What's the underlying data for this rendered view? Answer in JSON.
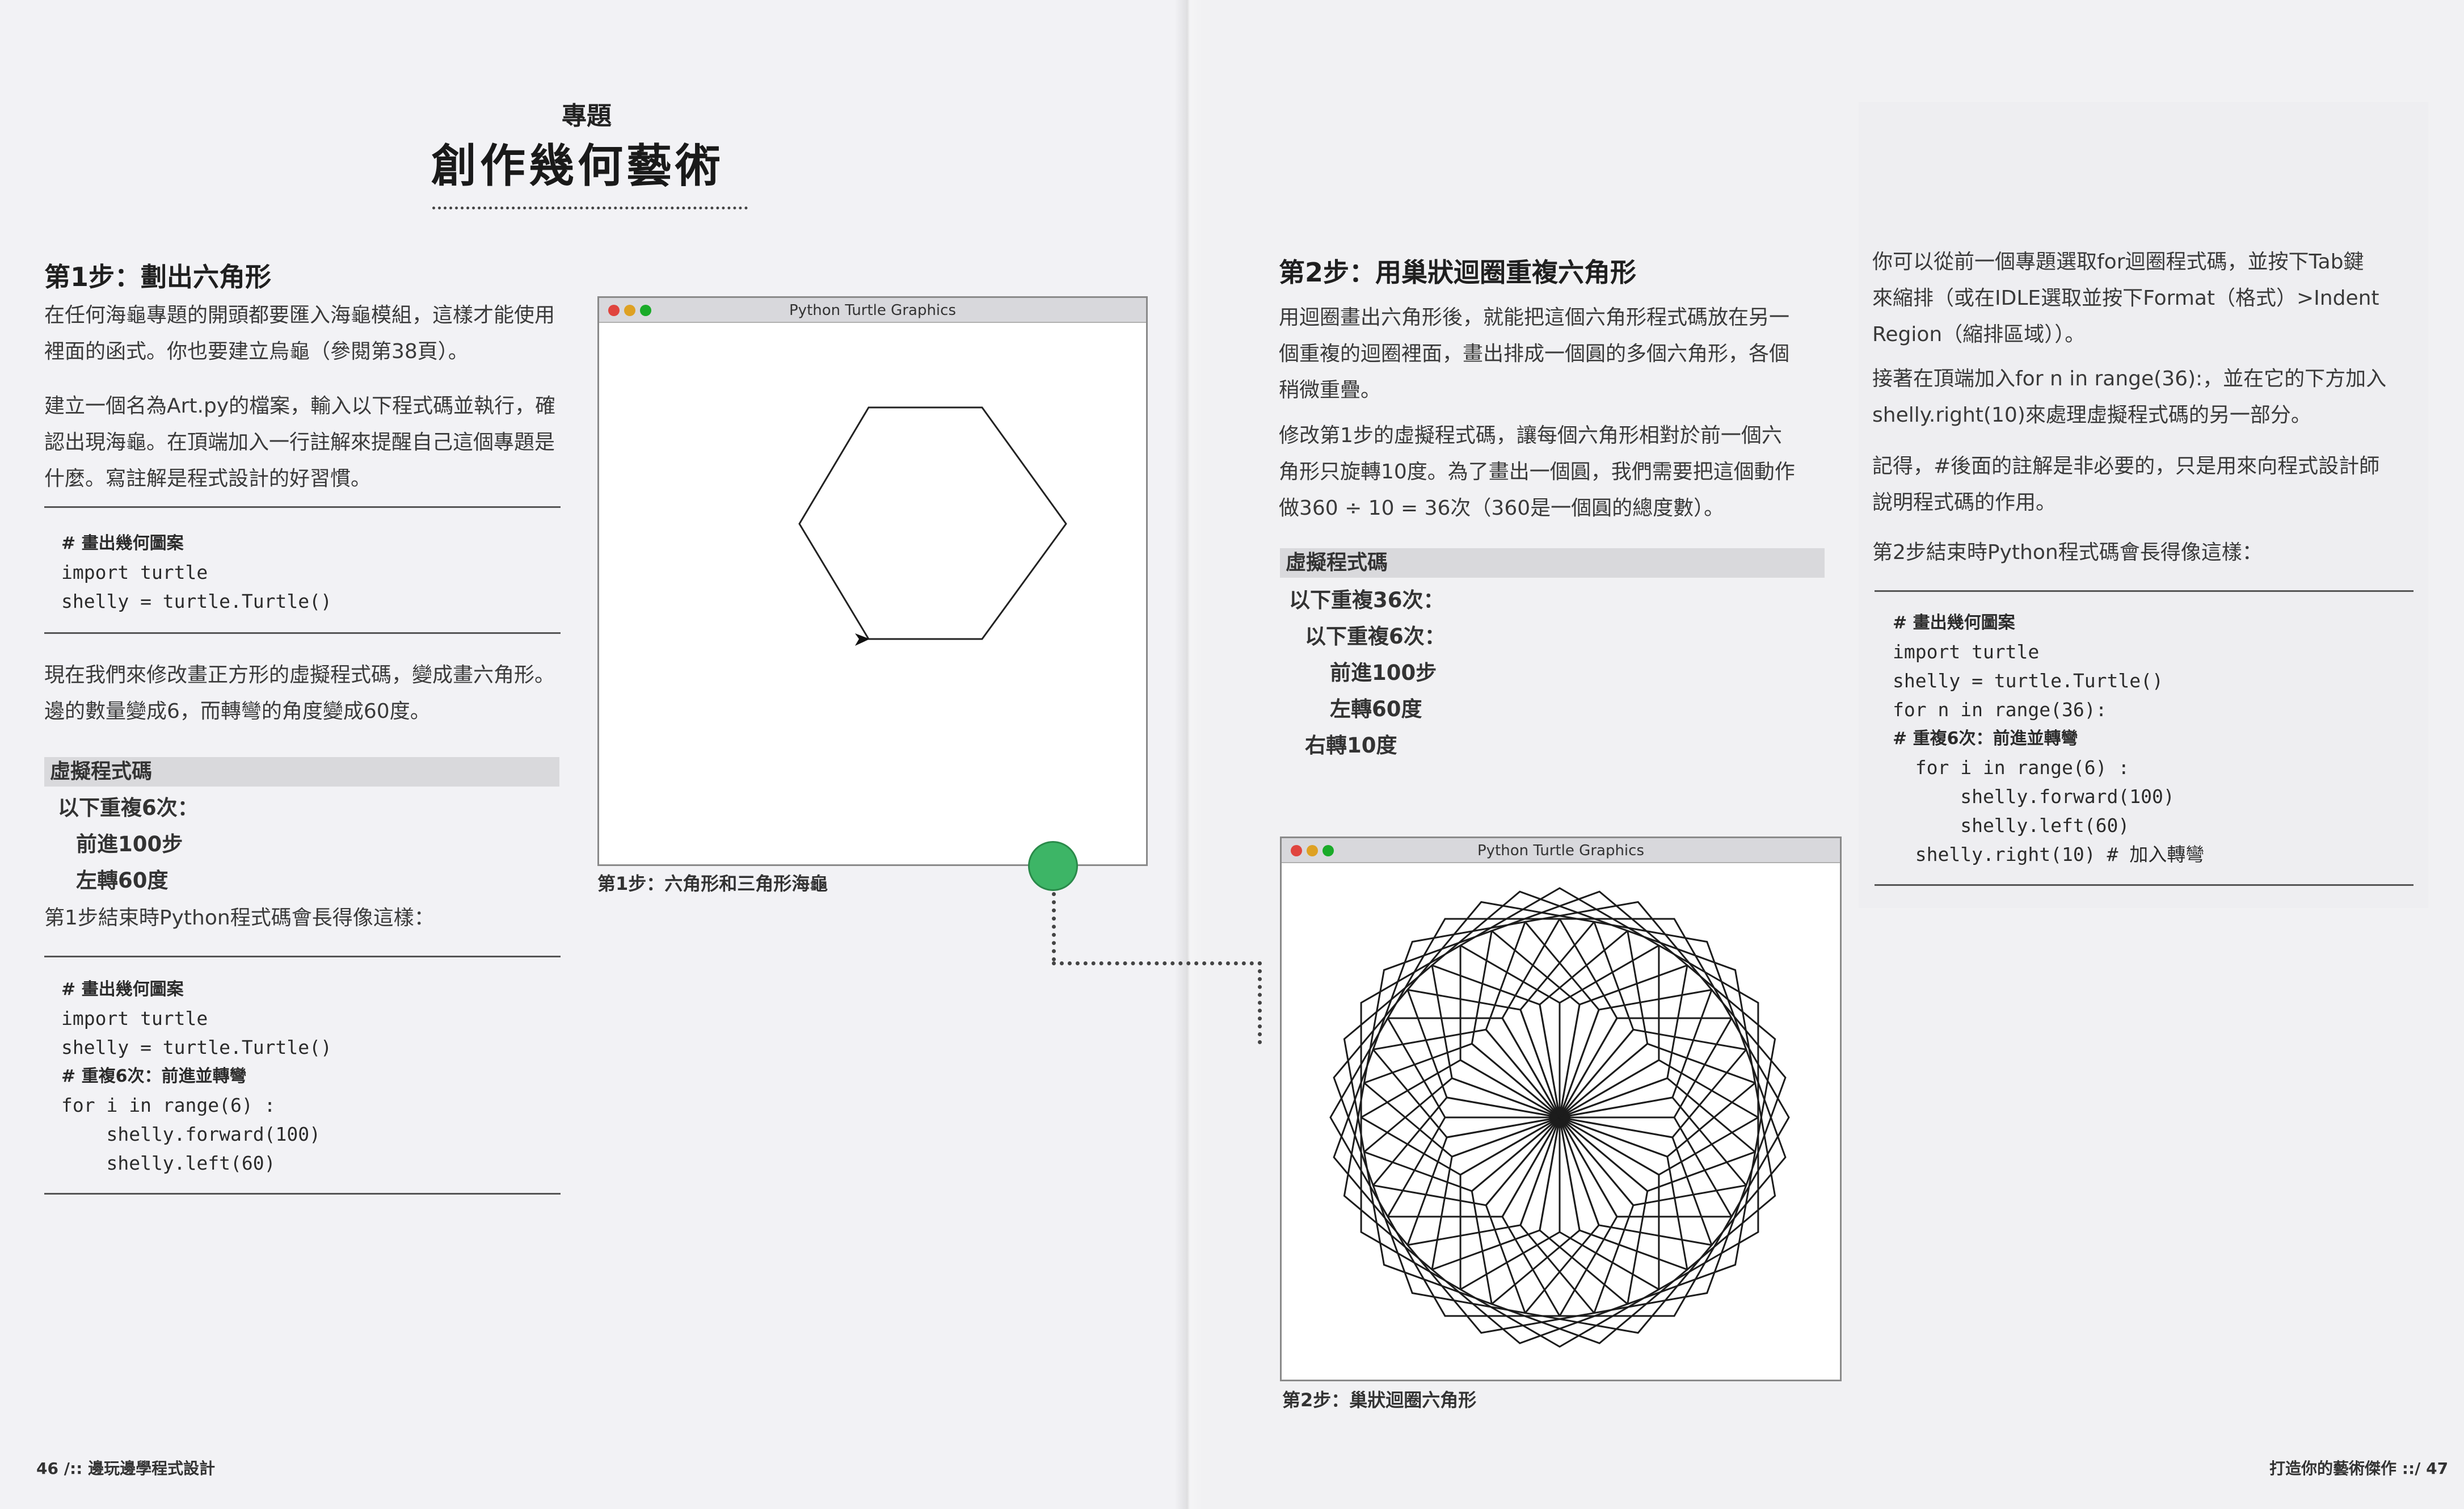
{
  "left": {
    "kicker": "專題",
    "title": "創作幾何藝術",
    "step1_heading": "第1步：劃出六角形",
    "intro_lines": [
      "在任何海龜專題的開頭都要匯入海龜模組，這樣才能使用",
      "裡面的函式。你也要建立烏龜（參閱第38頁）。"
    ],
    "file_lines": [
      "建立一個名為Art.py的檔案，輸入以下程式碼並執行，確",
      "認出現海龜。在頂端加入一行註解來提醒自己這個專題是",
      "什麼。寫註解是程式設計的好習慣。"
    ],
    "code1": [
      "# 畫出幾何圖案",
      "import turtle",
      "shelly = turtle.Turtle()"
    ],
    "change_lines": [
      "現在我們來修改畫正方形的虛擬程式碼，變成畫六角形。",
      "邊的數量變成6，而轉彎的角度變成60度。"
    ],
    "pseudo_heading": "虛擬程式碼",
    "pseudo": [
      "以下重複6次：",
      "前進100步",
      "左轉60度"
    ],
    "end_line": "第1步結束時Python程式碼會長得像這樣：",
    "code2": [
      "# 畫出幾何圖案",
      "import turtle",
      "shelly = turtle.Turtle()",
      "# 重複6次：前進並轉彎",
      "for i in range(6) :",
      "    shelly.forward(100)",
      "    shelly.left(60)"
    ],
    "window_title": "Python Turtle Graphics",
    "caption": "第1步：六角形和三角形海龜",
    "footer": "46 /:: 邊玩邊學程式設計"
  },
  "right": {
    "step2_heading": "第2步：用巢狀迴圈重複六角形",
    "para1": [
      "用迴圈畫出六角形後，就能把這個六角形程式碼放在另一",
      "個重複的迴圈裡面，畫出排成一個圓的多個六角形，各個",
      "稍微重疊。"
    ],
    "para2": [
      "修改第1步的虛擬程式碼，讓每個六角形相對於前一個六",
      "角形只旋轉10度。為了畫出一個圓，我們需要把這個動作",
      "做360 ÷ 10 = 36次（360是一個圓的總度數）。"
    ],
    "pseudo_heading": "虛擬程式碼",
    "pseudo": [
      "以下重複36次：",
      "以下重複6次：",
      "前進100步",
      "左轉60度",
      "右轉10度"
    ],
    "window_title": "Python Turtle Graphics",
    "caption": "第2步：巢狀迴圈六角形",
    "col_para1": [
      "你可以從前一個專題選取for迴圈程式碼，並按下Tab鍵",
      "來縮排（或在IDLE選取並按下Format（格式）>Indent",
      "Region（縮排區域））。"
    ],
    "col_para2": [
      "接著在頂端加入for n in range(36):，並在它的下方加入",
      "shelly.right(10)來處理虛擬程式碼的另一部分。"
    ],
    "col_para3": [
      "記得，#後面的註解是非必要的，只是用來向程式設計師",
      "說明程式碼的作用。"
    ],
    "col_end": "第2步結束時Python程式碼會長得像這樣：",
    "code3": [
      "# 畫出幾何圖案",
      "import turtle",
      "shelly = turtle.Turtle()",
      "for n in range(36):",
      "# 重複6次：前進並轉彎",
      "  for i in range(6) :",
      "      shelly.forward(100)",
      "      shelly.left(60)",
      "  shelly.right(10) # 加入轉彎"
    ],
    "footer": "打造你的藝術傑作 ::/ 47"
  },
  "colors": {
    "green_dot": "#3db566",
    "close": "#e0443e",
    "minimize": "#dea123",
    "zoom": "#1aab29"
  }
}
